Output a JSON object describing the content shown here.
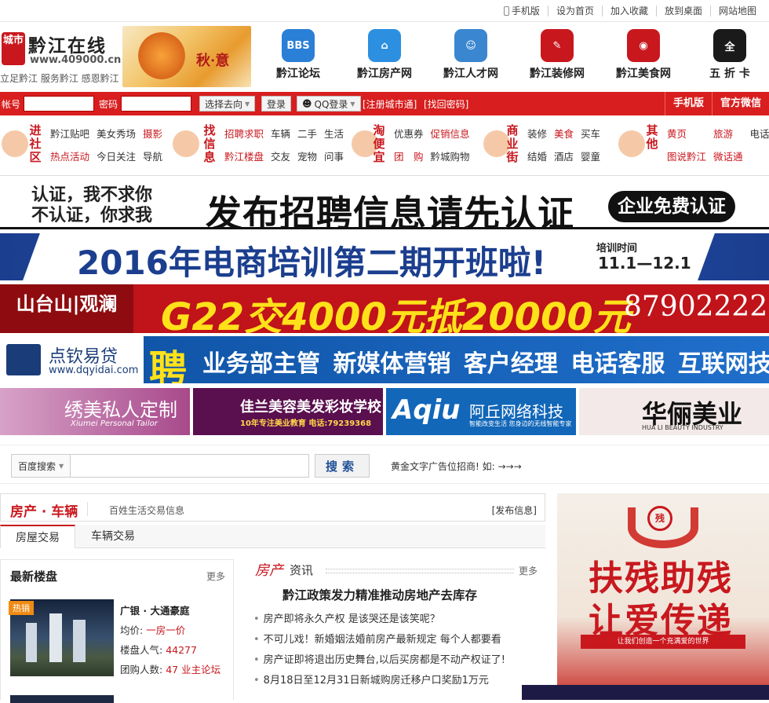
{
  "topbar": {
    "mobile": "手机版",
    "homepage": "设为首页",
    "favorite": "加入收藏",
    "desktop": "放到桌面",
    "sitemap": "网站地图"
  },
  "logo": {
    "seal": "城市",
    "name": "黔江在线",
    "url": "www.409000.cn",
    "slogan": "立足黔江  服务黔江  感恩黔江",
    "autumn": "秋·意"
  },
  "nav": [
    {
      "label": "黔江论坛",
      "icon": "bbs-icon",
      "text": "BBS",
      "color": "#2a7fd6"
    },
    {
      "label": "黔江房产网",
      "icon": "house-icon",
      "text": "⌂",
      "color": "#2c8fe0"
    },
    {
      "label": "黔江人才网",
      "icon": "people-icon",
      "text": "☺",
      "color": "#3a86d0"
    },
    {
      "label": "黔江装修网",
      "icon": "brush-icon",
      "text": "✎",
      "color": "#c8181e"
    },
    {
      "label": "黔江美食网",
      "icon": "lips-icon",
      "text": "◉",
      "color": "#c8181e"
    },
    {
      "label": "五 折 卡",
      "icon": "card-icon",
      "text": "全",
      "color": "#1a1a1a"
    }
  ],
  "login": {
    "account": "帐号",
    "password": "密码",
    "select": "选择去向",
    "login_btn": "登录",
    "qq": "QQ登录",
    "register": "[注册城市通]",
    "forgot": "[找回密码]",
    "mobile": "手机版",
    "weixin": "官方微信"
  },
  "cats": [
    {
      "title": "进社区",
      "items": [
        [
          "黔江贴吧",
          0
        ],
        [
          "美女秀场",
          0
        ],
        [
          "摄影",
          1
        ],
        [
          "热点活动",
          1
        ],
        [
          "今日关注",
          0
        ],
        [
          "导航",
          0
        ]
      ]
    },
    {
      "title": "找信息",
      "items": [
        [
          "招聘求职",
          1
        ],
        [
          "车辆",
          0
        ],
        [
          "二手",
          0
        ],
        [
          "生活",
          0
        ],
        [
          "黔江楼盘",
          1
        ],
        [
          "交友",
          0
        ],
        [
          "宠物",
          0
        ],
        [
          "问事",
          0
        ]
      ]
    },
    {
      "title": "淘便宜",
      "items": [
        [
          "优惠券",
          0
        ],
        [
          "促销信息",
          1
        ],
        [
          "团　购",
          1
        ],
        [
          "黔城购物",
          0
        ]
      ]
    },
    {
      "title": "商业街",
      "items": [
        [
          "装修",
          0
        ],
        [
          "美食",
          1
        ],
        [
          "买车",
          0
        ],
        [
          "结婚",
          0
        ],
        [
          "酒店",
          0
        ],
        [
          "婴童",
          0
        ]
      ]
    },
    {
      "title": "其他",
      "items": [
        [
          "黄页",
          1
        ],
        [
          "旅游",
          1
        ],
        [
          "电话",
          0
        ],
        [
          "图说黔江",
          1
        ],
        [
          "微话通",
          1
        ]
      ]
    }
  ],
  "banners": {
    "b1": {
      "a1": "认证，我不求你",
      "a2": "不认证，你求我",
      "main": "发布招聘信息请先认证",
      "btn": "企业免费认证"
    },
    "b2": {
      "main": "2016年电商培训第二期开班啦!",
      "sub": "培训时间",
      "dates": "11.1—12.1"
    },
    "b3": {
      "left": "山台山|观澜",
      "main": "G22交4000元抵20000元",
      "phone": "87902222"
    },
    "b4": {
      "name": "点钦易贷",
      "url": "www.dqyidai.com",
      "big": "聘",
      "jobs": "业务部主管 新媒体营销 客户经理 电话客服 互联网技术"
    },
    "s1": {
      "title": "绣美私人定制",
      "sub": "Xiumei Personal Tailor"
    },
    "s2": {
      "title": "佳兰美容美发彩妆学校",
      "sub": "10年专注美业教育  电话:79239368"
    },
    "s3": {
      "brand": "Aqiu",
      "title": "阿丘网络科技",
      "sub": "智能改变生活  您身边的无线智能专家"
    },
    "s4": {
      "title": "华俪美业",
      "sub": "HUA LI BEAUTY INDUSTRY"
    }
  },
  "search": {
    "select": "百度搜索",
    "btn": "搜索",
    "ad": "黄金文字广告位招商!  如: →→→"
  },
  "house": {
    "title": "房产 · 车辆",
    "subtitle": "百姓生活交易信息",
    "post": "[发布信息]",
    "tabs": [
      "房屋交易",
      "车辆交易"
    ],
    "newest": {
      "title": "最新楼盘",
      "more": "更多",
      "hot": "热销",
      "name": "广银 · 大通豪庭",
      "price_label": "均价:",
      "price": "一房一价",
      "pop_label": "楼盘人气:",
      "pop": "44277",
      "group_label": "团购人数:",
      "group": "47",
      "forum": "业主论坛"
    },
    "news": {
      "h1": "房产",
      "h2": "资讯",
      "more": "更多",
      "headline": "黔江政策发力精准推动房地产去库存",
      "items": [
        "房产即将永久产权 是该哭还是该笑呢？",
        "不可儿戏！新婚姻法婚前房产最新规定 每个人都要看",
        "房产证即将退出历史舞台,以后买房都是不动产权证了!",
        "8月18日至12月31日新城购房迁移户口奖励1万元"
      ]
    }
  },
  "rightad": {
    "logo": "残",
    "line1": "扶残助残",
    "line2": "让爱传递",
    "band": "让我们创造一个充满爱的世界"
  }
}
